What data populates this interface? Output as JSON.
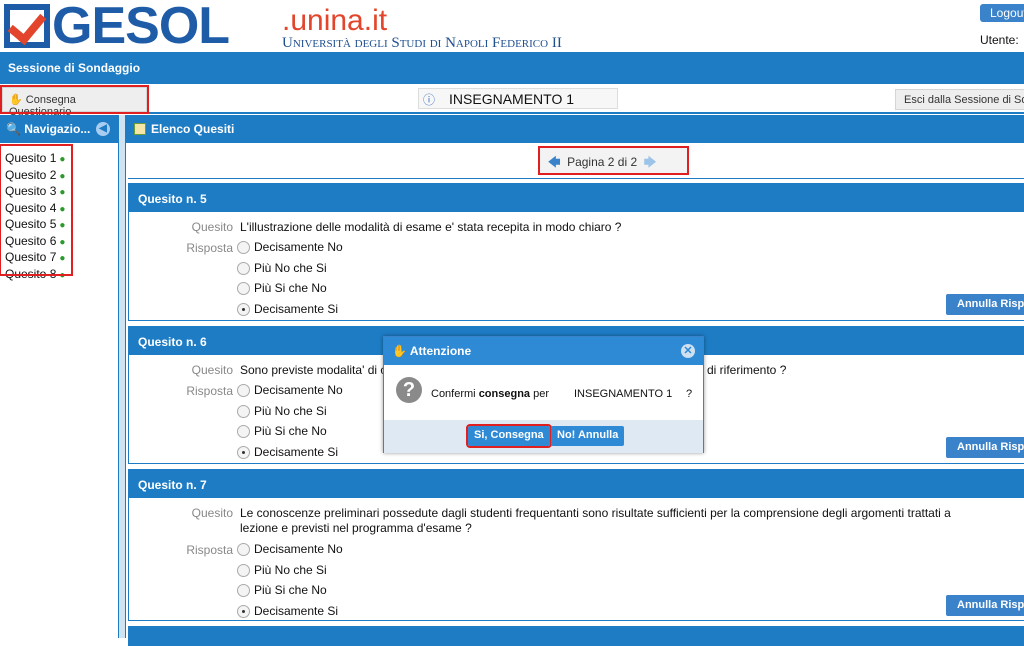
{
  "header": {
    "logo_text": "GESOL",
    "logo_domain": ".unina.it",
    "university": "Università degli Studi di Napoli Federico II",
    "logout_label": "Logout",
    "user_label": "Utente:"
  },
  "session_bar": {
    "title": "Sessione di Sondaggio"
  },
  "toolbar": {
    "consegna_label": "Consegna Questionario",
    "course": "INSEGNAMENTO 1",
    "exit_label": "Esci dalla Sessione di Sondaggio"
  },
  "nav": {
    "title": "Navigazio...",
    "items": [
      "Quesito 1",
      "Quesito 2",
      "Quesito 3",
      "Quesito 4",
      "Quesito 5",
      "Quesito 6",
      "Quesito 7",
      "Quesito 8"
    ]
  },
  "main": {
    "title": "Elenco Quesiti",
    "pager": "Pagina 2 di 2"
  },
  "labels": {
    "quesito": "Quesito",
    "risposta": "Risposta",
    "annulla": "Annulla Risposta"
  },
  "options": [
    "Decisamente No",
    "Più No che Si",
    "Più Si che No",
    "Decisamente Si"
  ],
  "questions": [
    {
      "title": "Quesito n. 5",
      "text": "L'illustrazione delle modalità di esame e' stata recepita in modo chiaro ?",
      "selected": 3
    },
    {
      "title": "Quesito n. 6",
      "text": "Sono previste modalita' di co",
      "text_end": "di riferimento ?",
      "selected": 3
    },
    {
      "title": "Quesito n. 7",
      "text": "Le conoscenze preliminari possedute dagli studenti frequentanti sono risultate sufficienti per la comprensione degli argomenti trattati a lezione e previsti nel programma d'esame ?",
      "selected": 3
    }
  ],
  "dialog": {
    "title": "Attenzione",
    "msg_pre": "Confermi ",
    "msg_bold": "consegna",
    "msg_post": " per",
    "target": "INSEGNAMENTO 1",
    "qm": "?",
    "confirm": "Si, Consegna",
    "cancel": "No! Annulla"
  },
  "colors": {
    "primary": "#1e7cc5",
    "highlight": "#e02020",
    "accent": "#e2452b"
  }
}
